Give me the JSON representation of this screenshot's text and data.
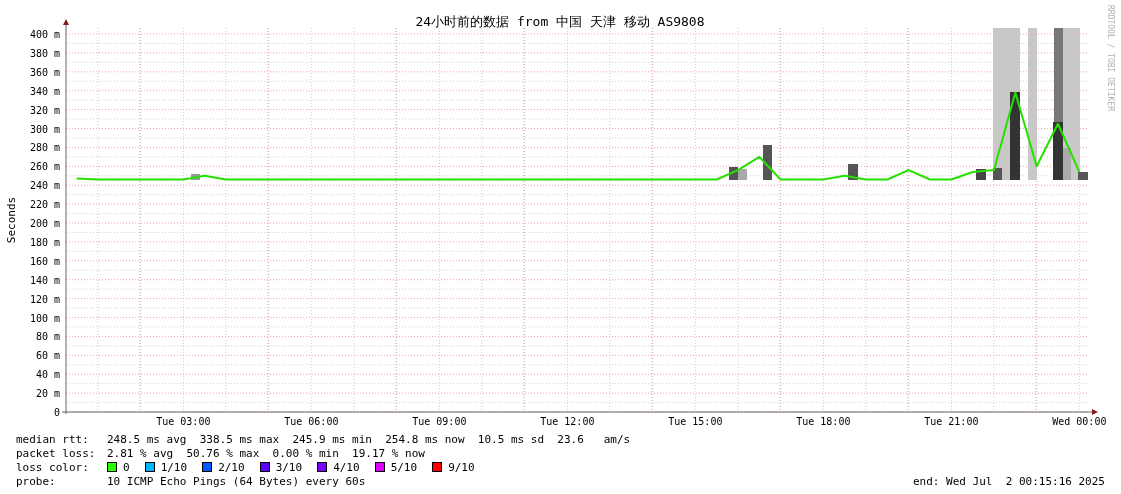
{
  "title": "24小时前的数据 from 中国 天津 移动 AS9808",
  "credit": "RRDTOOL / TOBI OETIKER",
  "chart_data": {
    "type": "line",
    "ylabel": "Seconds",
    "grid": true,
    "ylim": [
      0,
      400
    ],
    "categories": [
      null,
      null,
      null,
      null,
      null,
      "Tue 03:00",
      null,
      null,
      null,
      null,
      null,
      "Tue 06:00",
      null,
      null,
      null,
      null,
      null,
      "Tue 09:00",
      null,
      null,
      null,
      null,
      null,
      "Tue 12:00",
      null,
      null,
      null,
      null,
      null,
      "Tue 15:00",
      null,
      null,
      null,
      null,
      null,
      "Tue 18:00",
      null,
      null,
      null,
      null,
      null,
      "Tue 21:00",
      null,
      null,
      null,
      null,
      null,
      "Wed 00:00"
    ],
    "yticks": [
      {
        "value": 0,
        "label": "0"
      },
      {
        "value": 20,
        "label": "20 m"
      },
      {
        "value": 40,
        "label": "40 m"
      },
      {
        "value": 60,
        "label": "60 m"
      },
      {
        "value": 80,
        "label": "80 m"
      },
      {
        "value": 100,
        "label": "100 m"
      },
      {
        "value": 120,
        "label": "120 m"
      },
      {
        "value": 140,
        "label": "140 m"
      },
      {
        "value": 160,
        "label": "160 m"
      },
      {
        "value": 180,
        "label": "180 m"
      },
      {
        "value": 200,
        "label": "200 m"
      },
      {
        "value": 220,
        "label": "220 m"
      },
      {
        "value": 240,
        "label": "240 m"
      },
      {
        "value": 260,
        "label": "260 m"
      },
      {
        "value": 280,
        "label": "280 m"
      },
      {
        "value": 300,
        "label": "300 m"
      },
      {
        "value": 320,
        "label": "320 m"
      },
      {
        "value": 340,
        "label": "340 m"
      },
      {
        "value": 360,
        "label": "360 m"
      },
      {
        "value": 380,
        "label": "380 m"
      },
      {
        "value": 400,
        "label": "400 m"
      }
    ],
    "series": [
      {
        "name": "median rtt:",
        "color": "#26e000",
        "values": [
          247,
          246,
          246,
          246,
          246,
          246,
          250,
          246,
          246,
          246,
          246,
          246,
          246,
          246,
          246,
          246,
          246,
          246,
          246,
          246,
          246,
          246,
          246,
          246,
          246,
          246,
          246,
          246,
          246,
          246,
          246,
          256,
          270,
          246,
          246,
          246,
          250,
          246,
          246,
          256,
          246,
          246,
          254,
          256,
          338,
          260,
          305,
          254
        ]
      }
    ]
  },
  "legend": {
    "median": {
      "text": "248.5 ms avg  338.5 ms max  245.9 ms min  254.8 ms now  10.5 ms sd  23.6   am/s"
    },
    "loss": {
      "label": "packet loss:",
      "text": "2.81 % avg  50.76 % max  0.00 % min  19.17 % now"
    },
    "loss_colors_label": "loss color:",
    "loss_colors": [
      {
        "label": "0",
        "color": "#26ff00"
      },
      {
        "label": "1/10",
        "color": "#00b8ff"
      },
      {
        "label": "2/10",
        "color": "#0059ff"
      },
      {
        "label": "3/10",
        "color": "#5e00ff"
      },
      {
        "label": "4/10",
        "color": "#7e00ff"
      },
      {
        "label": "5/10",
        "color": "#dd00ff"
      },
      {
        "label": "9/10",
        "color": "#ff0000"
      }
    ],
    "probe": {
      "label": "probe:",
      "text": "10 ICMP Echo Pings (64 Bytes) every 60s"
    },
    "end": "end: Wed Jul  2 00:15:16 2025"
  }
}
